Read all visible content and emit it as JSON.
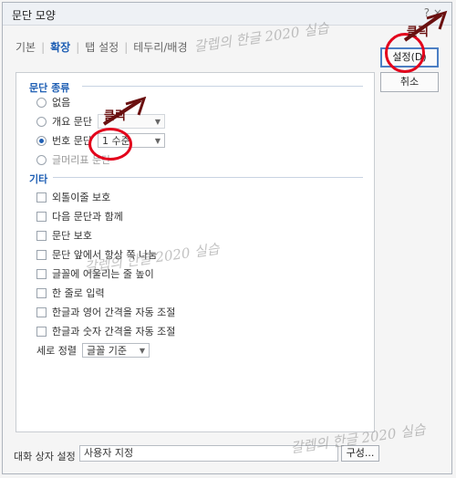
{
  "window": {
    "title": "문단 모양",
    "title_icons": "? ×"
  },
  "tabs": [
    "기본",
    "확장",
    "탭 설정",
    "테두리/배경"
  ],
  "active_tab": "확장",
  "sections": {
    "paragraph_type": {
      "label": "문단 종류",
      "options": [
        {
          "label": "없음",
          "selected": false
        },
        {
          "label": "개요 문단",
          "selected": false,
          "select_value": ""
        },
        {
          "label": "번호 문단",
          "selected": true,
          "select_value": "1 수준"
        },
        {
          "label": "글머리표 문단",
          "selected": false
        }
      ]
    },
    "etc": {
      "label": "기타",
      "checks": [
        "외톨이줄 보호",
        "다음 문단과 함께",
        "문단 보호",
        "문단 앞에서 항상 쪽 나눔",
        "글꼴에 어울리는 줄 높이",
        "한 줄로 입력",
        "한글과 영어 간격을 자동 조절",
        "한글과 숫자 간격을 자동 조절"
      ],
      "vertical_align_label": "세로 정렬",
      "vertical_align_value": "글꼴 기준"
    }
  },
  "buttons": {
    "ok": "설정(D)",
    "cancel": "취소"
  },
  "bottom": {
    "label": "대화 상자 설정",
    "value": "사용자 지정",
    "config_button": "구성..."
  },
  "annotations": {
    "watermark": "갈렙의 한글 2020 실습",
    "click_mark": "클릭"
  },
  "colors": {
    "accent": "#1f5fb4",
    "highlight": "#e3001b"
  }
}
